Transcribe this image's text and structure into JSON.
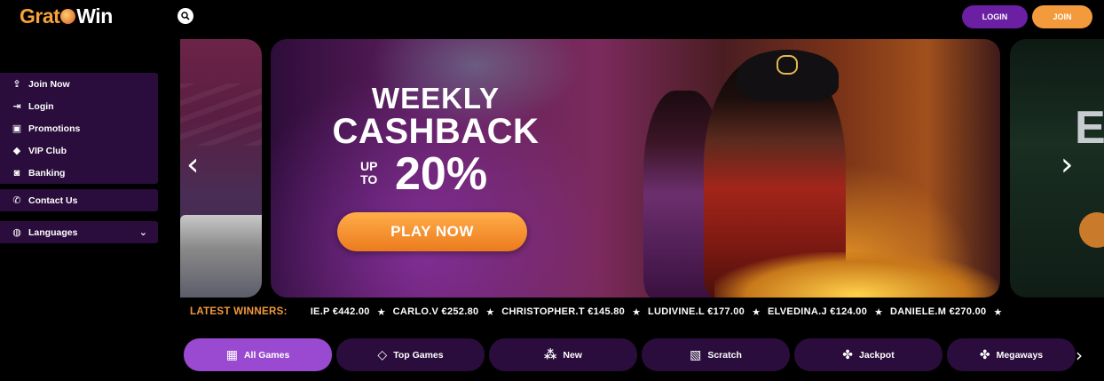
{
  "header": {
    "logo": {
      "part1": "Grat",
      "part2": "Win"
    },
    "login_label": "LOGIN",
    "join_label": "JOIN"
  },
  "sidebar": {
    "items": [
      {
        "label": "Join Now",
        "icon": "join-icon"
      },
      {
        "label": "Login",
        "icon": "login-icon"
      },
      {
        "label": "Promotions",
        "icon": "promotions-icon"
      },
      {
        "label": "VIP Club",
        "icon": "diamond-icon"
      },
      {
        "label": "Banking",
        "icon": "banking-icon"
      }
    ],
    "contact": {
      "label": "Contact Us",
      "icon": "phone-icon"
    },
    "languages": {
      "label": "Languages",
      "icon": "globe-icon"
    }
  },
  "banner": {
    "line1": "WEEKLY",
    "line2": "CASHBACK",
    "up": "UP",
    "to": "TO",
    "percent": "20%",
    "cta": "PLAY NOW",
    "next_slide_letter": "E"
  },
  "ticker": {
    "label": "LATEST WINNERS:",
    "entries": [
      "IE.P €442.00",
      "CARLO.V €252.80",
      "CHRISTOPHER.T €145.80",
      "LUDIVINE.L €177.00",
      "ELVEDINA.J €124.00",
      "DANIELE.M €270.00"
    ]
  },
  "tabs": [
    {
      "label": "All Games",
      "icon": "grid-icon",
      "active": true
    },
    {
      "label": "Top Games",
      "icon": "diamond-icon",
      "active": false
    },
    {
      "label": "New",
      "icon": "sparkle-icon",
      "active": false
    },
    {
      "label": "Scratch",
      "icon": "scratch-icon",
      "active": false
    },
    {
      "label": "Jackpot",
      "icon": "clover-icon",
      "active": false
    },
    {
      "label": "Megaways",
      "icon": "clover-icon",
      "active": false
    }
  ],
  "colors": {
    "accent": "#f29a3c",
    "purple": "#6b1fa3",
    "tab_active": "#9a4ad0",
    "panel": "#2a0d3c"
  }
}
